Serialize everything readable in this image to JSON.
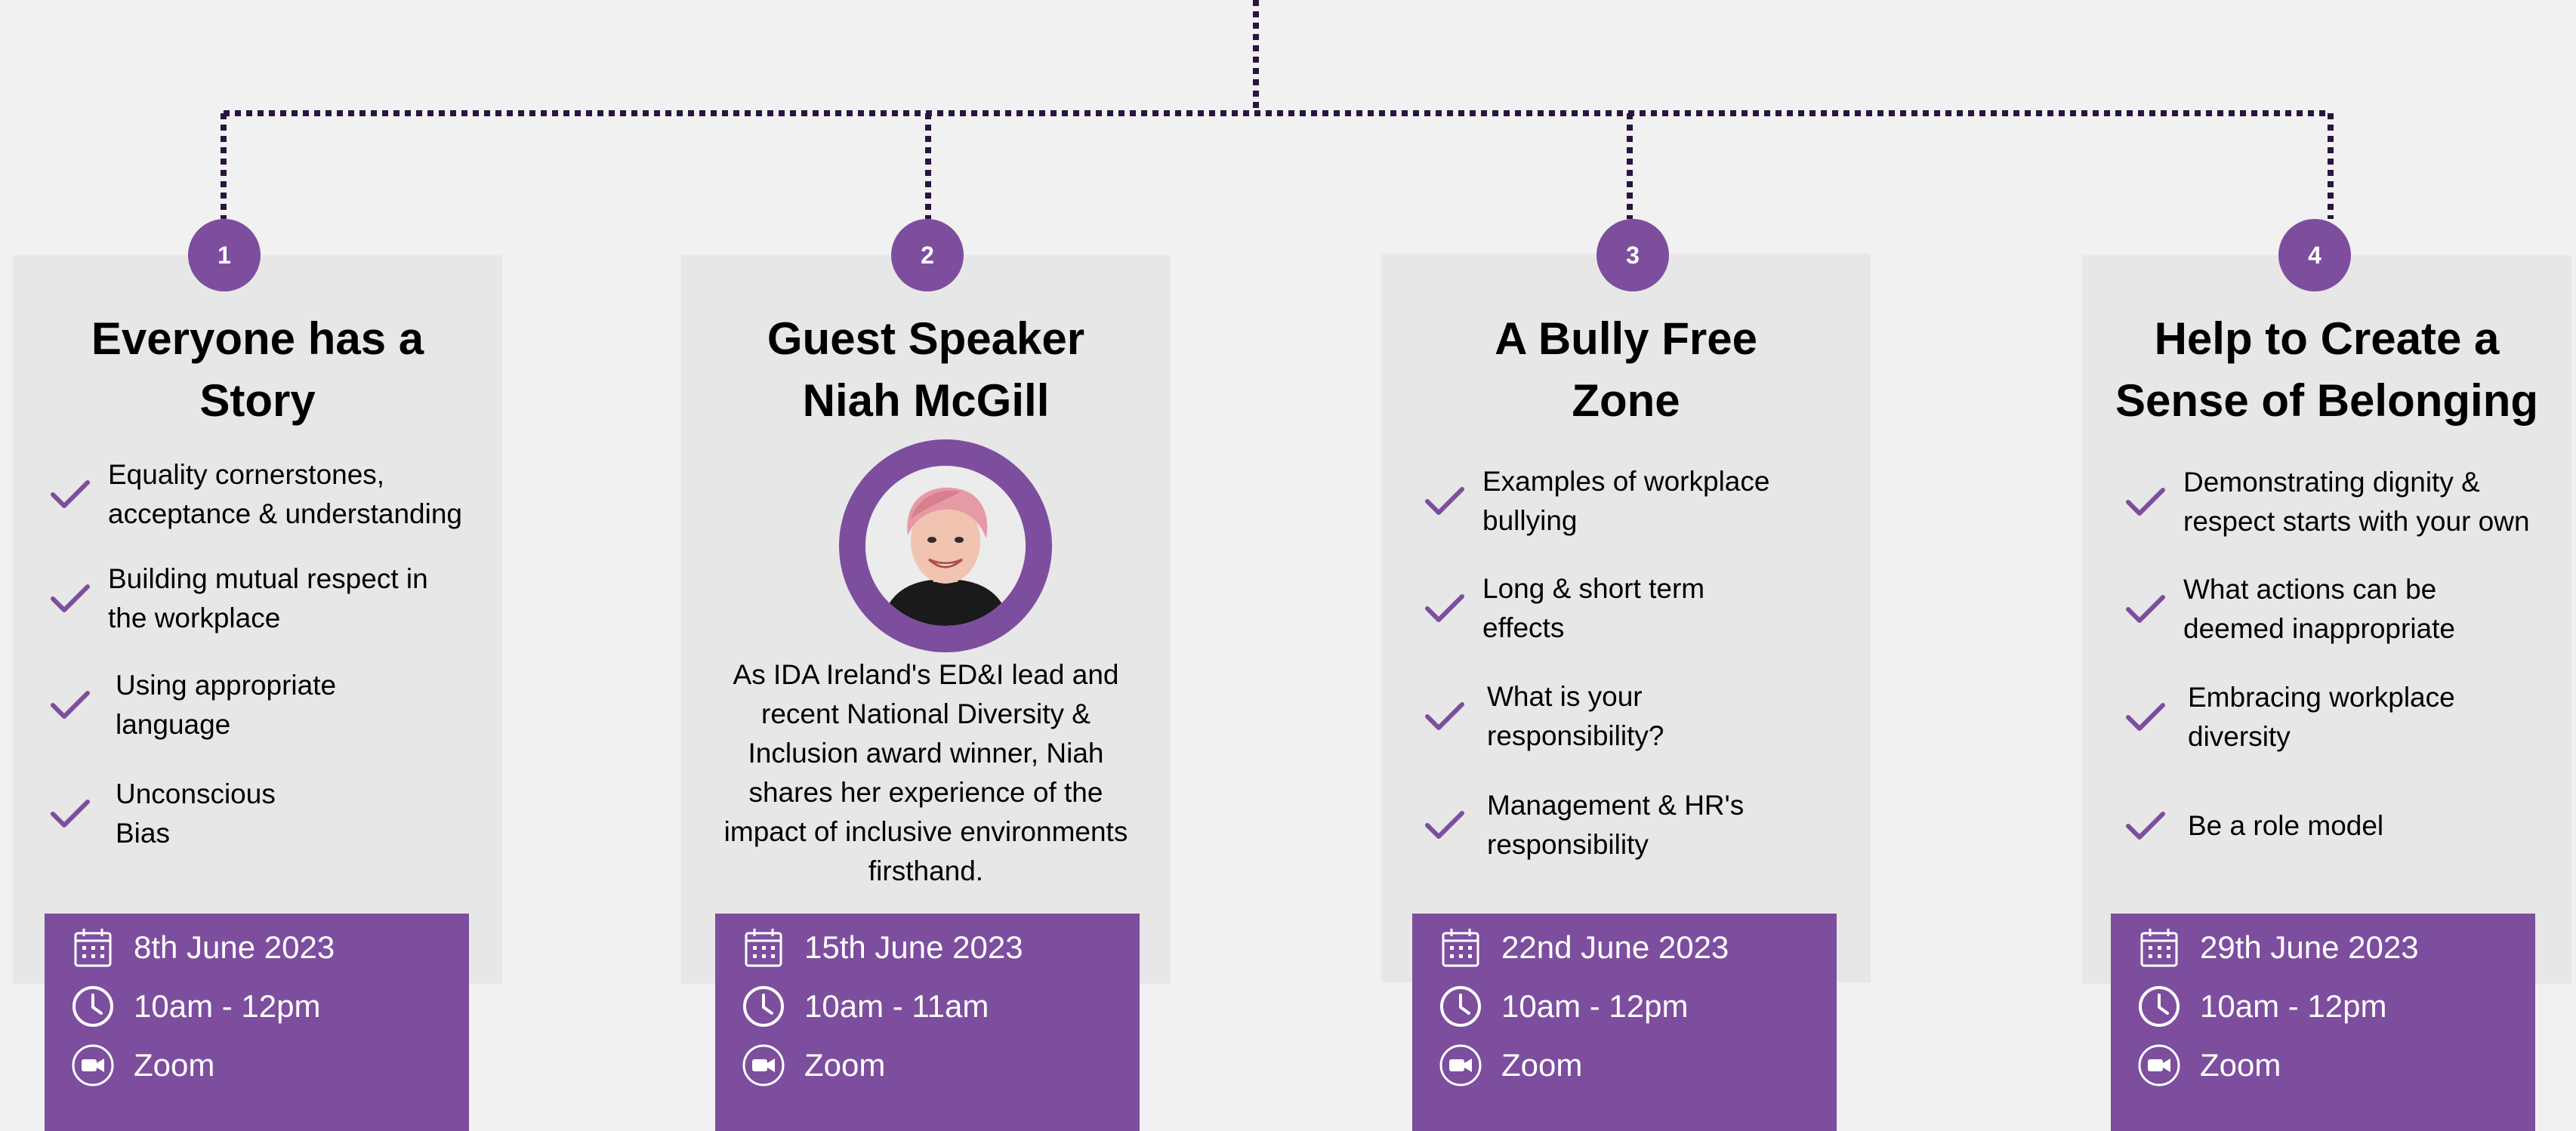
{
  "colors": {
    "accent": "#7d4e9e",
    "card_bg": "#e7e7e7",
    "page_bg": "#f1f1f1",
    "connector": "#2a1440"
  },
  "cards": [
    {
      "number": "1",
      "title": "Everyone has a\nStory",
      "items": [
        "Equality cornerstones,\nacceptance & understanding",
        "Building mutual respect in\nthe workplace",
        "Using appropriate\nlanguage",
        "Unconscious\nBias"
      ],
      "date": "8th June 2023",
      "time": "10am - 12pm",
      "platform": "Zoom"
    },
    {
      "number": "2",
      "title": "Guest Speaker\nNiah McGill",
      "description": "As IDA Ireland's ED&I lead and recent National Diversity & Inclusion award winner, Niah shares her experience of the impact of inclusive environments firsthand.",
      "date": "15th June 2023",
      "time": "10am - 11am",
      "platform": "Zoom"
    },
    {
      "number": "3",
      "title": "A Bully Free\nZone",
      "items": [
        "Examples of workplace\nbullying",
        "Long & short term\neffects",
        "What is your\nresponsibility?",
        "Management & HR's\nresponsibility"
      ],
      "date": "22nd June 2023",
      "time": "10am - 12pm",
      "platform": "Zoom"
    },
    {
      "number": "4",
      "title": "Help to Create a\nSense of Belonging",
      "items": [
        "Demonstrating dignity &\nrespect starts with your own",
        "What actions can be\ndeemed inappropriate",
        "Embracing workplace\ndiversity",
        "Be a role model"
      ],
      "date": "29th June 2023",
      "time": "10am - 12pm",
      "platform": "Zoom"
    }
  ],
  "icons": {
    "check": "check-icon",
    "date": "calendar-icon",
    "time": "clock-icon",
    "platform": "video-camera-icon"
  }
}
